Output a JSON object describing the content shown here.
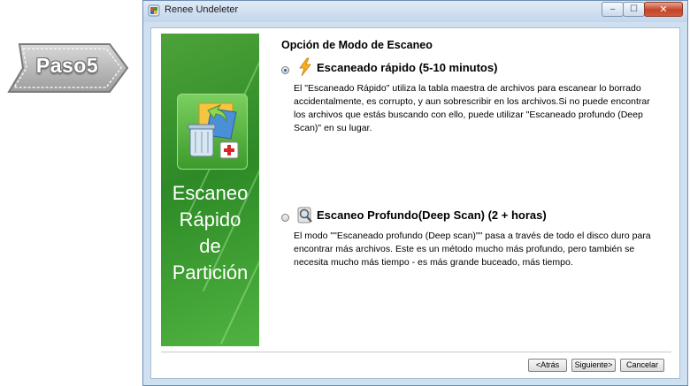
{
  "step_badge": {
    "label": "Paso5"
  },
  "window": {
    "title": "Renee Undeleter",
    "controls": {
      "minimize": "‒",
      "maximize": "☐",
      "close": "✕"
    }
  },
  "side_panel": {
    "title": "Escaneo\nRápido\nde\nPartición"
  },
  "content": {
    "section_title": "Opción de Modo de Escaneo",
    "options": [
      {
        "icon": "lightning-icon",
        "selected": true,
        "title": "Escaneado rápido (5-10 minutos)",
        "description": "El \"Escaneado Rápido\" utiliza la tabla maestra de archivos para escanear lo borrado accidentalmente, es corrupto,  y aun sobrescribir en los archivos.Si no puede encontrar los archivos que estás buscando con ello, puede utilizar \"Escaneado profundo (Deep Scan)\" en su lugar."
      },
      {
        "icon": "magnifier-icon",
        "selected": false,
        "title": "Escaneo Profundo(Deep Scan) (2 + horas)",
        "description": "El modo \"\"Escaneado profundo (Deep scan)\"\"  pasa a través de todo el disco duro para encontrar más archivos. Este es un método mucho más profundo, pero también se necesita mucho más tiempo - es más grande buceado, más tiempo."
      }
    ]
  },
  "buttons": {
    "back": "<Atrás",
    "next": "Siguiente>",
    "cancel": "Cancelar"
  }
}
